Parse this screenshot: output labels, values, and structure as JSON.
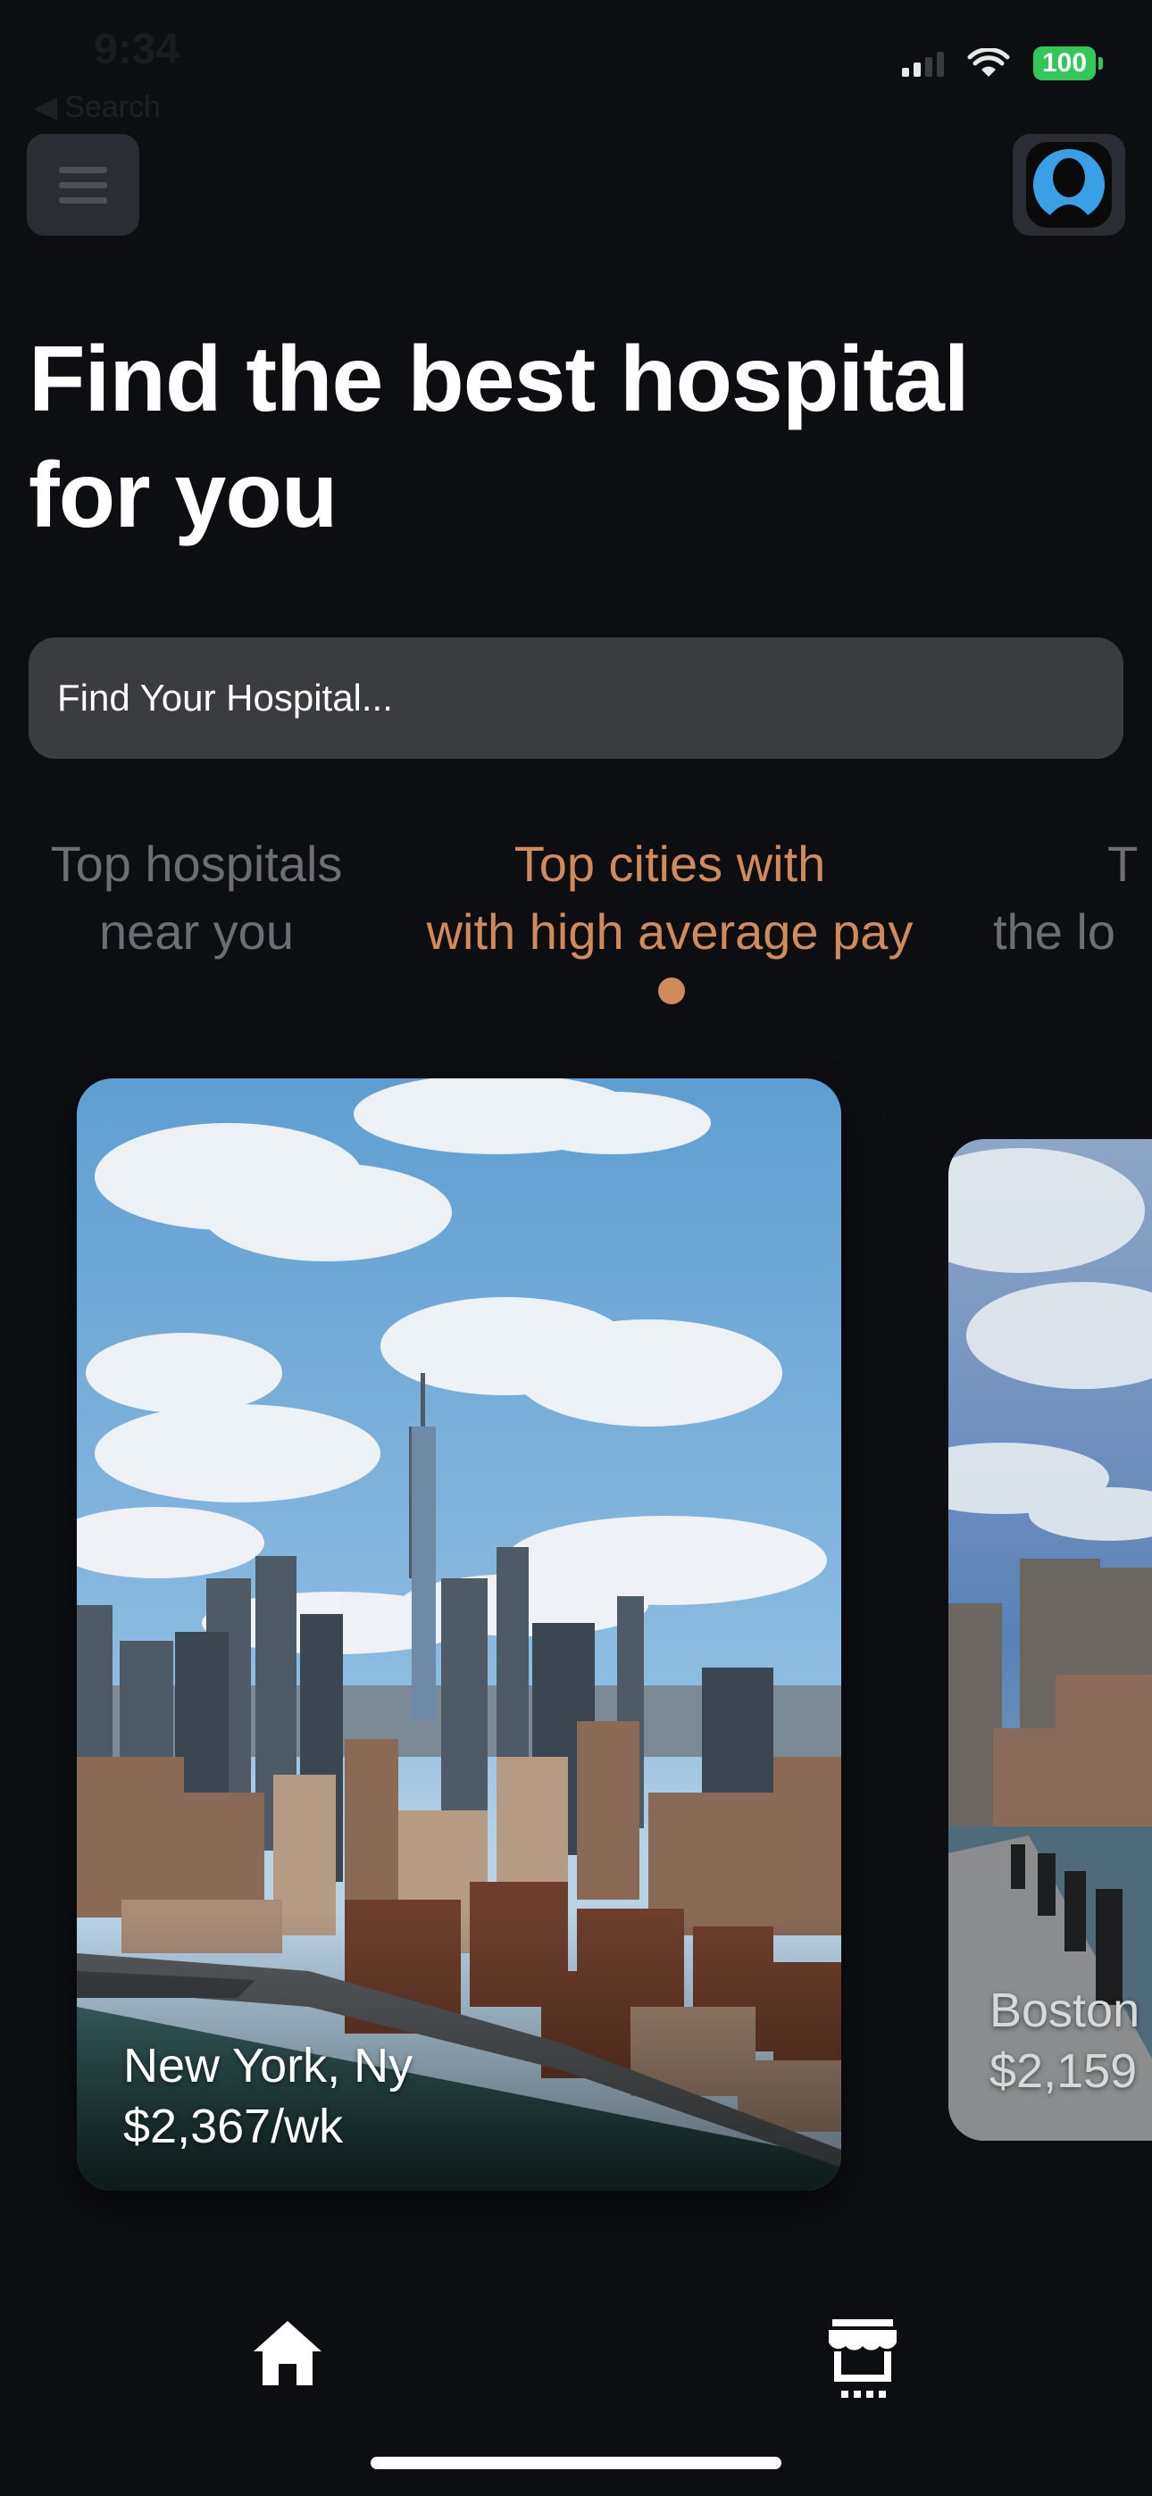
{
  "status_bar": {
    "time": "9:34",
    "battery": "100",
    "back_label": "Search"
  },
  "header": {
    "menu_icon": "hamburger-menu-icon",
    "avatar_icon": "user-avatar-icon"
  },
  "page": {
    "title": "Find the best hospital for you"
  },
  "search": {
    "placeholder": "Find Your Hospital..."
  },
  "tabs": [
    {
      "line1": "Top hospitals",
      "line2": "near you",
      "active": false
    },
    {
      "line1": "Top cities with",
      "line2": "with high average pay",
      "active": true
    },
    {
      "line1": "T",
      "line2": "the lo",
      "active": false
    }
  ],
  "cards": [
    {
      "city": "New York, Ny",
      "pay": "$2,367/wk"
    },
    {
      "city": "Boston",
      "pay": "$2,159"
    }
  ],
  "bottom_nav": [
    {
      "icon": "home-icon"
    },
    {
      "icon": "store-icon"
    }
  ],
  "colors": {
    "background": "#0c0e12",
    "accent": "#d18a5a",
    "surface": "#3a3c40",
    "battery": "#33c759"
  }
}
